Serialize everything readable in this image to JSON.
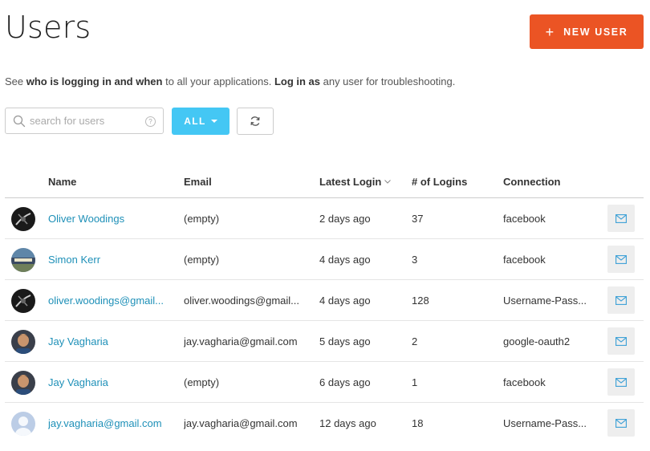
{
  "header": {
    "title": "Users",
    "new_user_label": "NEW USER",
    "accent_color": "#eb5424"
  },
  "subtitle": {
    "part1": "See ",
    "bold1": "who is logging in and when",
    "part2": " to all your applications. ",
    "bold2": "Log in as",
    "part3": " any user for troubleshooting."
  },
  "search": {
    "placeholder": "search for users",
    "value": ""
  },
  "filter": {
    "label": "ALL",
    "color": "#44c7f4"
  },
  "table": {
    "columns": {
      "name": "Name",
      "email": "Email",
      "latest_login": "Latest Login",
      "logins": "# of Logins",
      "connection": "Connection"
    },
    "link_color": "#1e90b8",
    "rows": [
      {
        "name": "Oliver Woodings",
        "email": "(empty)",
        "latest_login": "2 days ago",
        "logins": "37",
        "connection": "facebook",
        "avatar": "dark-photo"
      },
      {
        "name": "Simon Kerr",
        "email": "(empty)",
        "latest_login": "4 days ago",
        "logins": "3",
        "connection": "facebook",
        "avatar": "landscape-photo"
      },
      {
        "name": "oliver.woodings@gmail...",
        "email": "oliver.woodings@gmail...",
        "latest_login": "4 days ago",
        "logins": "128",
        "connection": "Username-Pass...",
        "avatar": "dark-photo"
      },
      {
        "name": "Jay Vagharia",
        "email": "jay.vagharia@gmail.com",
        "latest_login": "5 days ago",
        "logins": "2",
        "connection": "google-oauth2",
        "avatar": "face-photo"
      },
      {
        "name": "Jay Vagharia",
        "email": "(empty)",
        "latest_login": "6 days ago",
        "logins": "1",
        "connection": "facebook",
        "avatar": "face-photo"
      },
      {
        "name": "jay.vagharia@gmail.com",
        "email": "jay.vagharia@gmail.com",
        "latest_login": "12 days ago",
        "logins": "18",
        "connection": "Username-Pass...",
        "avatar": "default-silhouette"
      }
    ]
  }
}
